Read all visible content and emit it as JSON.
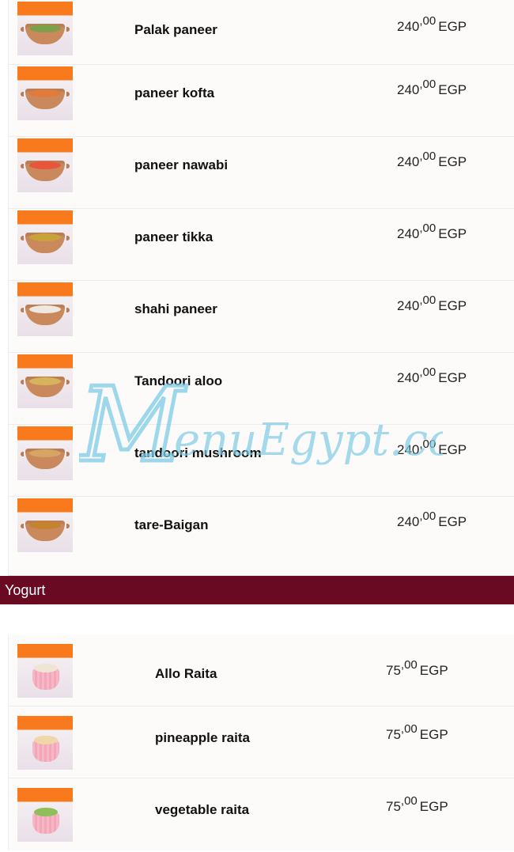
{
  "main_section": {
    "items": [
      {
        "name": "Palak paneer",
        "price_int": "240",
        "price_dec": ",00",
        "currency": "EGP",
        "food_color": "#7da04a"
      },
      {
        "name": "paneer kofta",
        "price_int": "240",
        "price_dec": ",00",
        "currency": "EGP",
        "food_color": "#e27a3c"
      },
      {
        "name": "paneer nawabi",
        "price_int": "240",
        "price_dec": ",00",
        "currency": "EGP",
        "food_color": "#e9553a"
      },
      {
        "name": "paneer tikka",
        "price_int": "240",
        "price_dec": ",00",
        "currency": "EGP",
        "food_color": "#c9a33a"
      },
      {
        "name": "shahi paneer",
        "price_int": "240",
        "price_dec": ",00",
        "currency": "EGP",
        "food_color": "#efe8e0"
      },
      {
        "name": "Tandoori aloo",
        "price_int": "240",
        "price_dec": ",00",
        "currency": "EGP",
        "food_color": "#d7b35b"
      },
      {
        "name": "tandoori mushroom",
        "price_int": "240",
        "price_dec": ",00",
        "currency": "EGP",
        "food_color": "#d6a563"
      },
      {
        "name": "tare-Baigan",
        "price_int": "240",
        "price_dec": ",00",
        "currency": "EGP",
        "food_color": "#c4832c"
      }
    ]
  },
  "yogurt_section": {
    "title": "Yogurt",
    "bar_color": "#6a0a22",
    "items": [
      {
        "name": "Allo Raita",
        "price_int": "75",
        "price_dec": ",00",
        "currency": "EGP",
        "food_color": "#efe5d5"
      },
      {
        "name": "pineapple raita",
        "price_int": "75",
        "price_dec": ",00",
        "currency": "EGP",
        "food_color": "#f1d6a8"
      },
      {
        "name": "vegetable raita",
        "price_int": "75",
        "price_dec": ",00",
        "currency": "EGP",
        "food_color": "#8fbf5a"
      }
    ]
  },
  "watermark": {
    "text": "MenuEgypt.com",
    "color": "#7ecbe6"
  }
}
